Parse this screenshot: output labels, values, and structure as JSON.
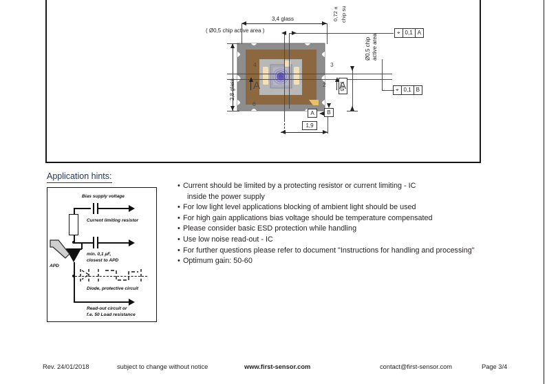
{
  "document": {
    "type": "datasheet-page",
    "colors": {
      "heading": "#1f3864",
      "body_text": "#231f20",
      "package_body": "#8b6840",
      "package_rim": "#8d8d8d",
      "die_gray": "#b8b8b8",
      "bond_pad": "#f2e0b8",
      "active_area": "#6b5fb8",
      "line": "#2b2b2b"
    }
  },
  "drawing": {
    "panel_label": "mechanical-drawing",
    "cut_off_notes": [
      {
        "text": "0,72 ±",
        "name": "chip-thickness-note"
      },
      {
        "text": "chip su",
        "name": "chip-surface-note"
      }
    ],
    "dimensions": {
      "glass_width": "3,4 glass",
      "glass_height": "2,8 glass",
      "active_area_top": "( Ø0,5 chip active area )",
      "active_area_right_line1": "Ø0,5 chip",
      "active_area_right_line2": "active area",
      "offset_vertical": "1,65",
      "offset_horizontal": "1,9"
    },
    "pin_numbers": [
      "4",
      "3",
      "6",
      "2"
    ],
    "datums": [
      "A",
      "B"
    ],
    "section_markers": [
      "A",
      "A"
    ],
    "gdt_frames": [
      {
        "symbol": "⌖",
        "tolerance": "0,1",
        "datum": "A"
      },
      {
        "symbol": "⌖",
        "tolerance": "0,1",
        "datum": "B"
      }
    ]
  },
  "app_hints": {
    "heading": "Application hints:",
    "circuit": {
      "name": "apd-bias-circuit-diagram",
      "labels": {
        "bias": "Bias supply voltage",
        "resistor": "Current limiting resistor",
        "cap_line1": "min. 0,1 µF,",
        "cap_line2": "closest to APD",
        "diode": "Diode, protective circuit",
        "readout_line1": "Read-out circuit or",
        "readout_line2": "f.e. 50 Load resistance",
        "apd": "APD"
      }
    },
    "bullets": [
      "Current should be limited by a protecting resistor or current limiting - IC\n  inside the power supply",
      "For low light level applications blocking of ambient light should be used",
      "For high gain applications bias voltage should be temperature compensated",
      "Please consider basic ESD protection while handling",
      "Use low noise read-out - IC",
      "For further questions please refer to document \"Instructions for handling and processing\"",
      "Optimum gain: 50-60"
    ],
    "bullet_marker": "•"
  },
  "footer": {
    "revision": "Rev. 24/01/2018",
    "notice": "subject to change without notice",
    "website": "www.first-sensor.com",
    "email": "contact@first-sensor.com",
    "page": "Page 3/4"
  }
}
